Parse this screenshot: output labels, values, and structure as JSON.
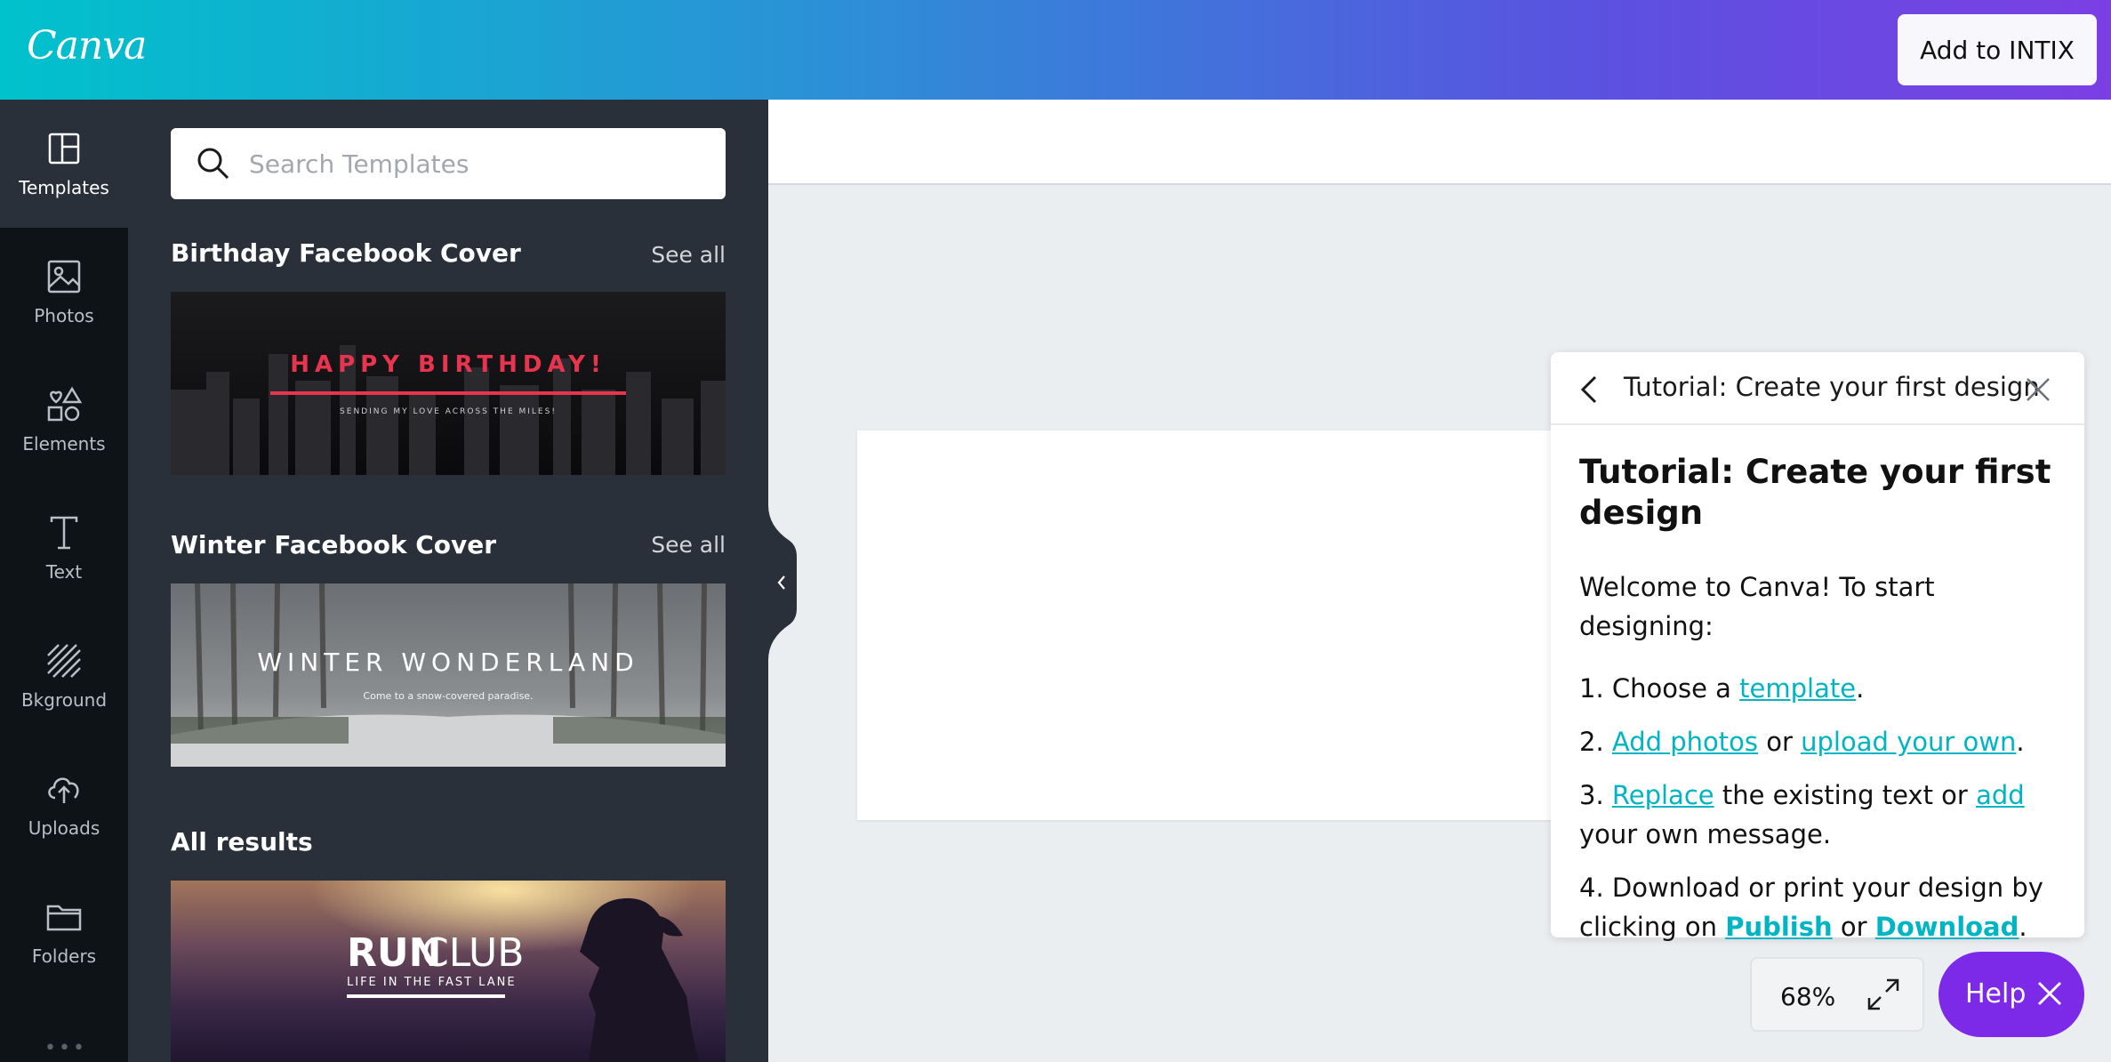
{
  "header": {
    "logo": "Canva",
    "add_button": "Add to INTIX"
  },
  "rail": {
    "items": [
      {
        "label": "Templates",
        "icon": "templates-icon"
      },
      {
        "label": "Photos",
        "icon": "photo-icon"
      },
      {
        "label": "Elements",
        "icon": "shapes-icon"
      },
      {
        "label": "Text",
        "icon": "text-icon"
      },
      {
        "label": "Bkground",
        "icon": "background-icon"
      },
      {
        "label": "Uploads",
        "icon": "upload-icon"
      },
      {
        "label": "Folders",
        "icon": "folder-icon"
      }
    ],
    "more": "•••"
  },
  "panel": {
    "search_placeholder": "Search Templates",
    "sections": [
      {
        "title": "Birthday Facebook Cover",
        "see_all": "See all",
        "thumb_title": "HAPPY BIRTHDAY!",
        "thumb_sub": "SENDING MY LOVE ACROSS THE MILES!"
      },
      {
        "title": "Winter Facebook Cover",
        "see_all": "See all",
        "thumb_title": "WINTER WONDERLAND",
        "thumb_sub": "Come to a snow-covered paradise."
      }
    ],
    "all_results": "All results",
    "result_thumb": {
      "word1": "RUN",
      "word2": "CLUB",
      "sub": "LIFE IN THE FAST LANE"
    }
  },
  "tutorial": {
    "header_title": "Tutorial: Create your first design",
    "title": "Tutorial: Create your first design",
    "welcome": "Welcome to Canva! To start designing:",
    "step1": {
      "num": "1. ",
      "pre": "Choose a ",
      "link": "template",
      "post": "."
    },
    "step2": {
      "num": "2. ",
      "link1": "Add photos",
      "mid": " or ",
      "link2": "upload your own",
      "post": "."
    },
    "step3": {
      "num": "3. ",
      "link1": "Replace",
      "mid": " the existing text or ",
      "link2": "add",
      "post": " your own message."
    },
    "step4": {
      "num": "4. ",
      "pre": "Download or print your design by clicking on ",
      "link1": "Publish",
      "mid": " or ",
      "link2": "Download",
      "post": "."
    }
  },
  "controls": {
    "zoom": "68%",
    "help": "Help"
  },
  "colors": {
    "accent": "#00b5c3",
    "help_purple": "#7d2ae8",
    "panel_bg": "#293039",
    "rail_bg": "#0e1318",
    "birthday_red": "#e8344e"
  }
}
